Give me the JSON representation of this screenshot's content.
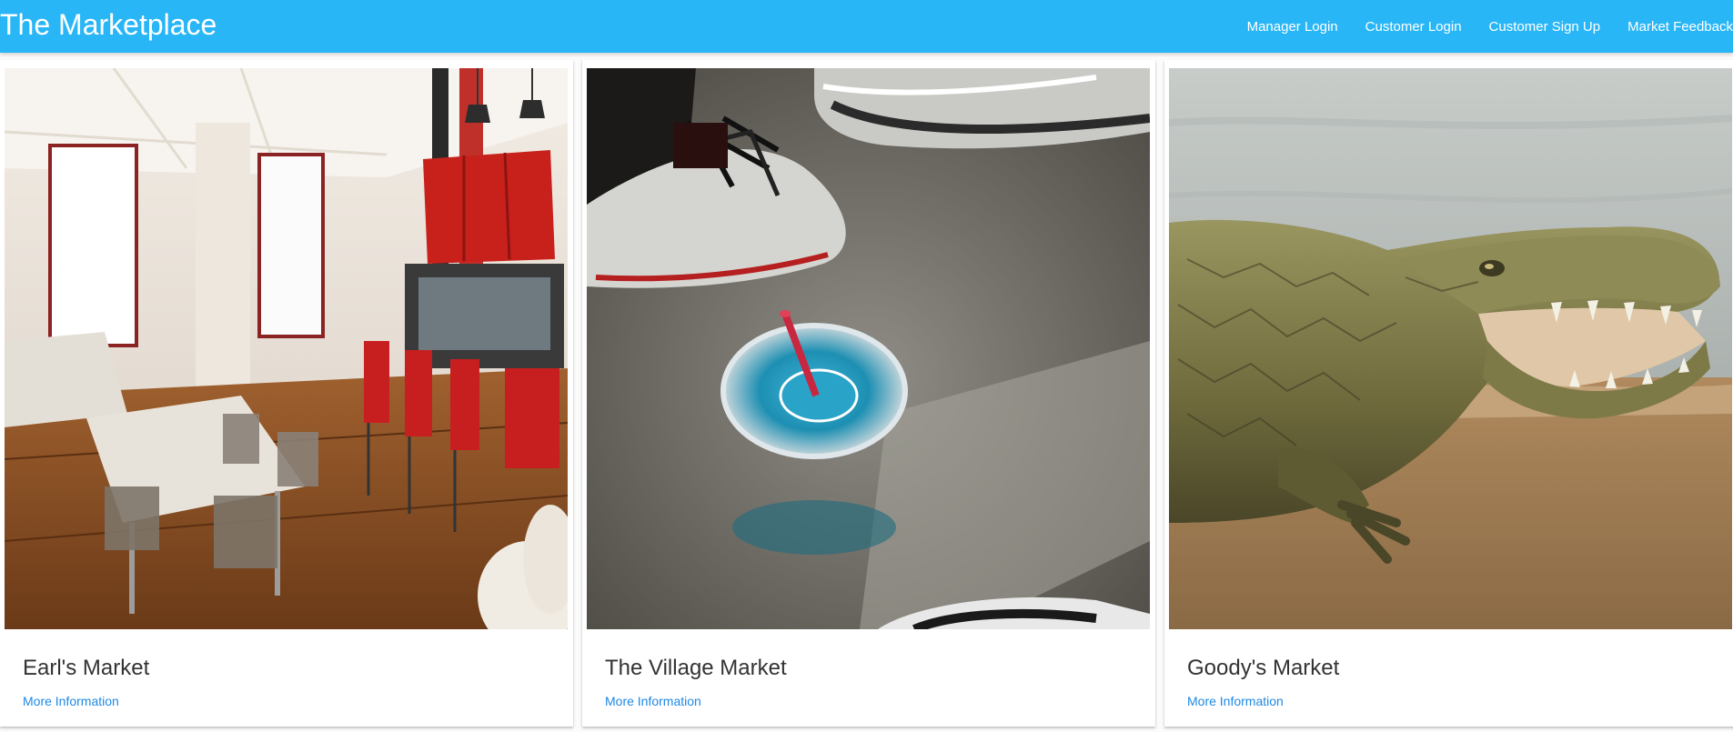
{
  "navbar": {
    "brand": "The Marketplace",
    "links": [
      {
        "label": "Manager Login"
      },
      {
        "label": "Customer Login"
      },
      {
        "label": "Customer Sign Up"
      },
      {
        "label": "Market Feedback"
      }
    ],
    "background_color": "#29b6f6"
  },
  "markets": [
    {
      "name": "Earl's Market",
      "link_label": "More Information",
      "image_subject": "restaurant-interior"
    },
    {
      "name": "The Village Market",
      "link_label": "More Information",
      "image_subject": "drink-cup-on-floor"
    },
    {
      "name": "Goody's Market",
      "link_label": "More Information",
      "image_subject": "crocodile"
    }
  ],
  "link_color": "#1e88e5"
}
